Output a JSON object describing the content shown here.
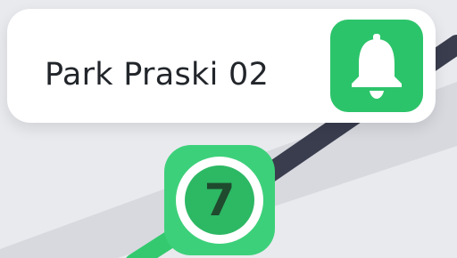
{
  "stop": {
    "name": "Park Praski 02"
  },
  "alert_button": {
    "icon": "bell-icon"
  },
  "route": {
    "number": "7"
  },
  "colors": {
    "background": "#e9eaee",
    "card": "#ffffff",
    "accent_green": "#2cc46a",
    "route_line_green": "#34c96f",
    "track_dark": "#3a3d4e",
    "track_light": "#d7d9df"
  }
}
